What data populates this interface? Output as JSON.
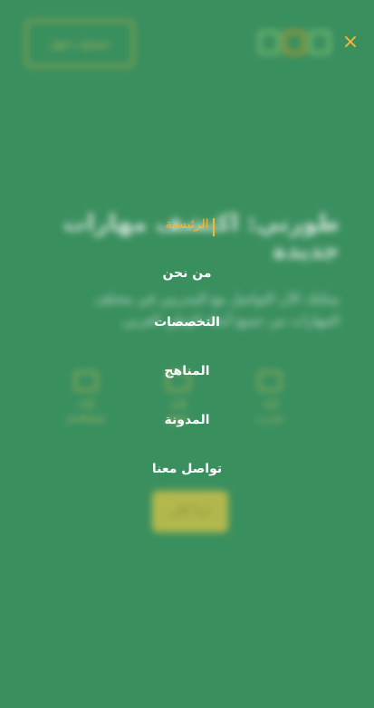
{
  "background": {
    "login_button": "تسجيل دخول",
    "hero_title": "طورني: اكتشف مهارات جديدة",
    "hero_subtitle": "يمكنك الآن التواصل مع المدربين في مختلف المهارات من جميع أنحاء الوطن العربي.",
    "stats": [
      {
        "value": "+0",
        "label": "مستخدم",
        "icon": "users-icon"
      },
      {
        "value": "+0",
        "label": "منهج",
        "icon": "book-icon"
      },
      {
        "value": "+0",
        "label": "مدرب",
        "icon": "trainer-icon"
      }
    ],
    "cta_button": "ابدأ الآن"
  },
  "overlay": {
    "close_icon": "×",
    "menu": [
      {
        "label": "الرئيسية",
        "active": true
      },
      {
        "label": "من نحن",
        "active": false
      },
      {
        "label": "التخصصات",
        "active": false
      },
      {
        "label": "المناهج",
        "active": false
      },
      {
        "label": "المدونة",
        "active": false
      },
      {
        "label": "تواصل معنا",
        "active": false
      }
    ]
  },
  "colors": {
    "background": "#3a8f5f",
    "accent": "#f5b833",
    "menu_text": "#ffffff"
  }
}
